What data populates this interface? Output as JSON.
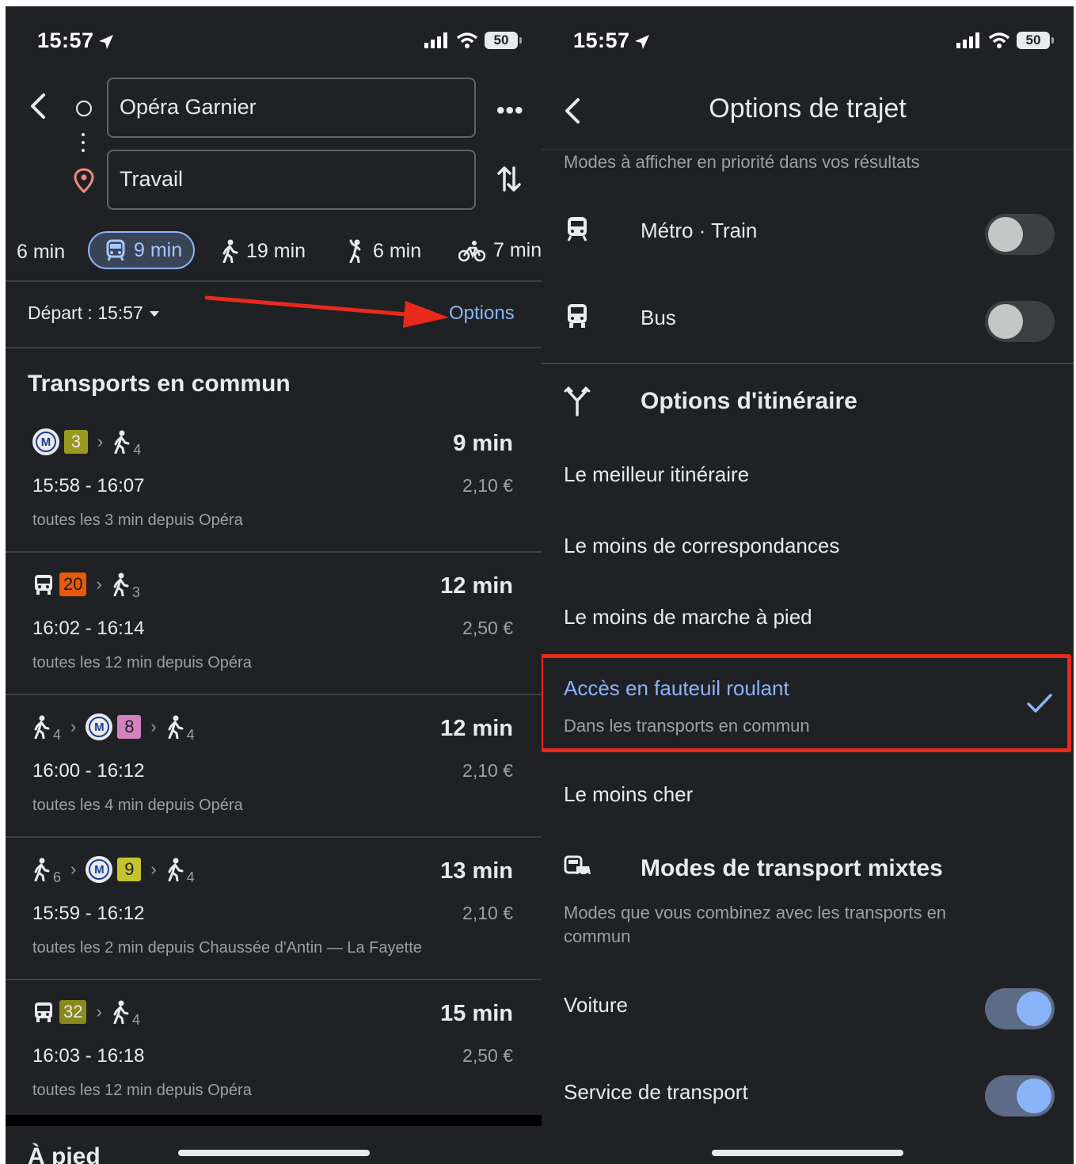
{
  "left": {
    "status_time": "15:57",
    "battery": "50",
    "origin": "Opéra Garnier",
    "destination": "Travail",
    "modes": [
      {
        "label": "6 min",
        "icon": "car-icon"
      },
      {
        "label": "9 min",
        "icon": "transit-icon",
        "selected": true
      },
      {
        "label": "19 min",
        "icon": "walk-icon"
      },
      {
        "label": "6 min",
        "icon": "ride-icon"
      },
      {
        "label": "7 min",
        "icon": "bike-icon"
      }
    ],
    "depart": "Départ : 15:57",
    "options_link": "Options",
    "section_title": "Transports en commun",
    "routes": [
      {
        "duration": "9 min",
        "times": "15:58 - 16:07",
        "price": "2,10 €",
        "freq": "toutes les 3 min depuis Opéra",
        "line": "3",
        "walk_start": "",
        "walk_end": "4"
      },
      {
        "duration": "12 min",
        "times": "16:02 - 16:14",
        "price": "2,50 €",
        "freq": "toutes les 12 min depuis Opéra",
        "line": "20",
        "walk_start": "",
        "walk_end": "3"
      },
      {
        "duration": "12 min",
        "times": "16:00 - 16:12",
        "price": "2,10 €",
        "freq": "toutes les 4 min depuis Opéra",
        "line": "8",
        "walk_start": "4",
        "walk_end": "4"
      },
      {
        "duration": "13 min",
        "times": "15:59 - 16:12",
        "price": "2,10 €",
        "freq": "toutes les 2 min depuis Chaussée d'Antin — La Fayette",
        "line": "9",
        "walk_start": "6",
        "walk_end": "4"
      },
      {
        "duration": "15 min",
        "times": "16:03 - 16:18",
        "price": "2,50 €",
        "freq": "toutes les 12 min depuis Opéra",
        "line": "32",
        "walk_start": "",
        "walk_end": "4"
      }
    ],
    "metro_letter": "M",
    "next_section": "À pied"
  },
  "right": {
    "status_time": "15:57",
    "battery": "50",
    "title": "Options de trajet",
    "subtitle": "Modes à afficher en priorité dans vos résultats",
    "metro_train": "Métro · Train",
    "bus": "Bus",
    "route_options_title": "Options d'itinéraire",
    "route_options": {
      "best": "Le meilleur itinéraire",
      "fewer_transfers": "Le moins de correspondances",
      "less_walking": "Le moins de marche à pied",
      "wheelchair": "Accès en fauteuil roulant",
      "wheelchair_sub": "Dans les transports en commun",
      "cheapest": "Le moins cher"
    },
    "mixed_title": "Modes de transport mixtes",
    "mixed_desc": "Modes que vous combinez avec les transports en commun",
    "car": "Voiture",
    "ride_service": "Service de transport",
    "toggles": {
      "metro_train": false,
      "bus": false,
      "car": true,
      "ride_service": true
    }
  },
  "colors": {
    "background": "#202124",
    "accent": "#8ab4f8",
    "highlight": "#e8291c"
  }
}
